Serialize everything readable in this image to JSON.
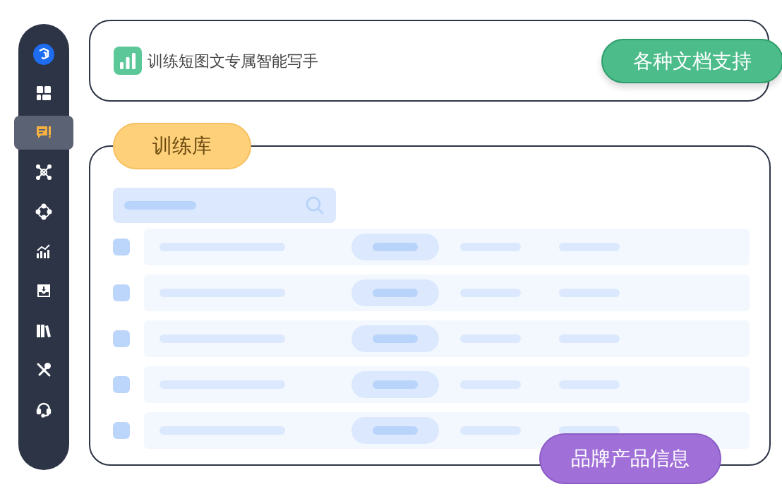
{
  "sidebar": {
    "items": [
      {
        "selected": false
      },
      {
        "selected": true
      },
      {
        "selected": false
      },
      {
        "selected": false
      },
      {
        "selected": false
      },
      {
        "selected": false
      },
      {
        "selected": false
      },
      {
        "selected": false
      },
      {
        "selected": false
      }
    ]
  },
  "header": {
    "title": "训练短图文专属智能写手",
    "badge": "各种文档支持"
  },
  "library": {
    "tab": "训练库",
    "badge": "品牌产品信息",
    "rows": [
      {
        "kind": "skeleton",
        "checked": false
      },
      {
        "kind": "skeleton",
        "checked": false
      },
      {
        "kind": "skeleton",
        "checked": false
      },
      {
        "kind": "skeleton",
        "checked": false
      },
      {
        "kind": "skeleton",
        "checked": false
      }
    ]
  }
}
